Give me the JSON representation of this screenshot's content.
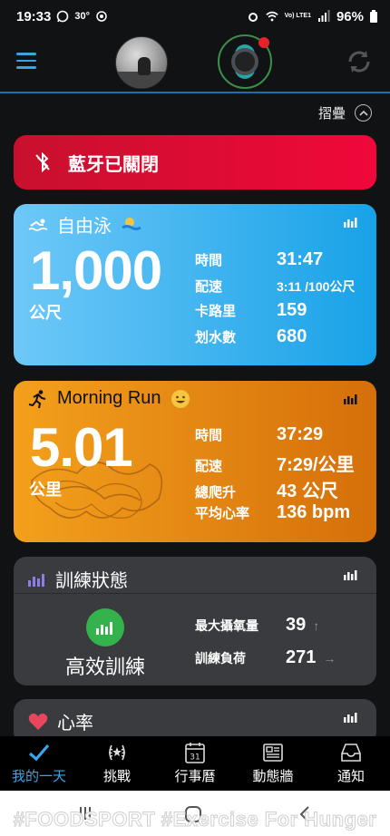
{
  "status_bar": {
    "time": "19:33",
    "temperature": "30°",
    "battery": "96%",
    "network": "Vo) LTE1"
  },
  "header": {
    "menu_icon": "hamburger-icon",
    "sync_icon": "sync-icon",
    "watch_notification_color": "#e8202c"
  },
  "collapse": {
    "label": "摺疊"
  },
  "bluetooth": {
    "label": "藍牙已關閉"
  },
  "swim": {
    "title": "自由泳",
    "value": "1,000",
    "unit": "公尺",
    "metrics": [
      {
        "label": "時間",
        "value": "31:47"
      },
      {
        "label": "配速",
        "value": "3:11 /100公尺"
      },
      {
        "label": "卡路里",
        "value": "159"
      },
      {
        "label": "划水數",
        "value": "680"
      }
    ]
  },
  "run": {
    "title": "Morning Run",
    "value": "5.01",
    "unit": "公里",
    "metrics": [
      {
        "label": "時間",
        "value": "37:29"
      },
      {
        "label": "配速",
        "value": "7:29/公里"
      },
      {
        "label": "總爬升",
        "value": "43 公尺"
      },
      {
        "label": "平均心率",
        "value": "136 bpm"
      }
    ]
  },
  "training": {
    "title": "訓練狀態",
    "status": "高效訓練",
    "metrics": [
      {
        "label": "最大攝氧量",
        "value": "39",
        "trend": "↑"
      },
      {
        "label": "訓練負荷",
        "value": "271",
        "trend": "→"
      }
    ]
  },
  "heart_rate": {
    "title": "心率"
  },
  "bottom_nav": [
    {
      "label": "我的一天",
      "icon": "check-icon"
    },
    {
      "label": "挑戰",
      "icon": "laurel-icon"
    },
    {
      "label": "行事曆",
      "icon": "calendar-icon"
    },
    {
      "label": "動態牆",
      "icon": "newsfeed-icon"
    },
    {
      "label": "通知",
      "icon": "inbox-icon"
    }
  ],
  "calendar_day": "31",
  "watermark": "#FOODSPORT #Exercise For Hunger",
  "colors": {
    "accent": "#37a6ea",
    "bluetooth_card": "#e8102e",
    "swim_card": "#18a2e8",
    "run_card": "#e0850f",
    "training_badge": "#34b24c"
  }
}
